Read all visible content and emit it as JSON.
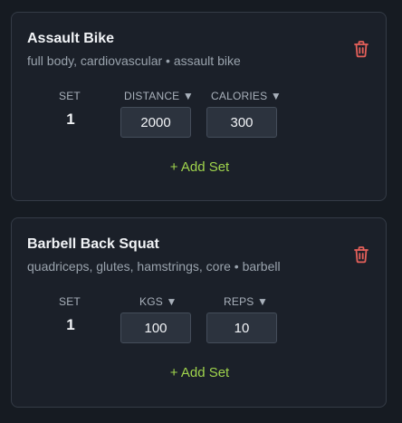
{
  "exercises": [
    {
      "name": "Assault Bike",
      "meta": "full body, cardiovascular • assault bike",
      "set_header": "SET",
      "col1_header": "DISTANCE ▼",
      "col2_header": "CALORIES ▼",
      "set_number": "1",
      "col1_value": "2000",
      "col2_value": "300",
      "add_set_label": "+ Add Set"
    },
    {
      "name": "Barbell Back Squat",
      "meta": "quadriceps, glutes, hamstrings, core • barbell",
      "set_header": "SET",
      "col1_header": "KGS ▼",
      "col2_header": "REPS ▼",
      "set_number": "1",
      "col1_value": "100",
      "col2_value": "10",
      "add_set_label": "+ Add Set"
    }
  ],
  "colors": {
    "accent": "#9fd34c",
    "danger": "#e5605a",
    "card_bg": "#1b2029"
  }
}
